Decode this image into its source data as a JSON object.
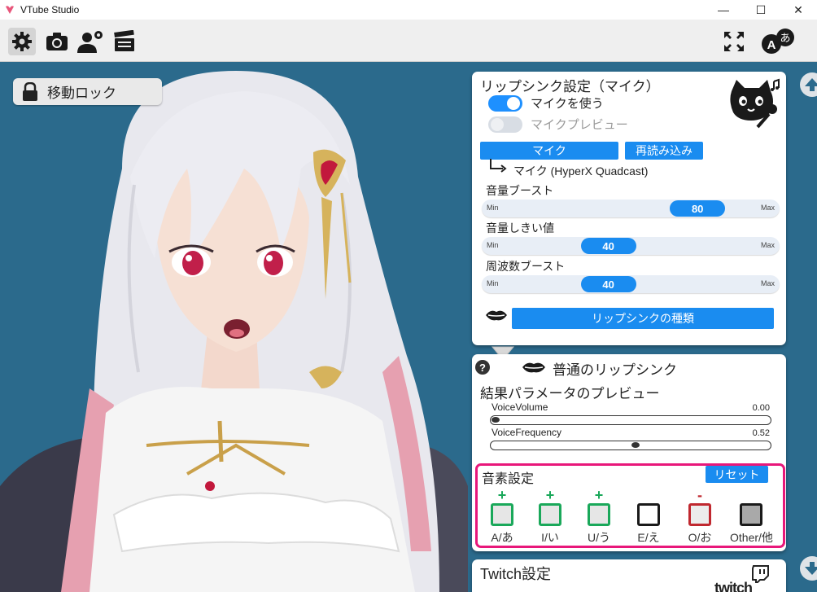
{
  "window": {
    "title": "VTube Studio",
    "controls": [
      "—",
      "☐",
      "✕"
    ]
  },
  "toolbar": {
    "left_icons": [
      "gear-icon",
      "camera-icon",
      "user-settings-icon",
      "clapperboard-icon"
    ],
    "right_icons": [
      "fullscreen-icon",
      "language-icon"
    ]
  },
  "stage": {
    "lock_label": "移動ロック"
  },
  "mic_panel": {
    "title": "リップシンク設定（マイク）",
    "use_mic_label": "マイクを使う",
    "use_mic_on": true,
    "mic_preview_label": "マイクプレビュー",
    "mic_preview_on": false,
    "mic_button": "マイク",
    "reload_button": "再読み込み",
    "mic_device": "マイク (HyperX Quadcast)",
    "sliders": [
      {
        "label": "音量ブースト",
        "value": "80",
        "level": 0.8,
        "min": "Min",
        "max": "Max"
      },
      {
        "label": "音量しきい値",
        "value": "40",
        "level": 0.4,
        "min": "Min",
        "max": "Max"
      },
      {
        "label": "周波数ブースト",
        "value": "40",
        "level": 0.4,
        "min": "Min",
        "max": "Max"
      }
    ],
    "lipsync_type_button": "リップシンクの種類"
  },
  "lipsync_panel": {
    "help": "?",
    "mode_title": "普通のリップシンク",
    "preview_title": "結果パラメータのプレビュー",
    "params": [
      {
        "name": "VoiceVolume",
        "value": "0.00",
        "level": 0.0
      },
      {
        "name": "VoiceFrequency",
        "value": "0.52",
        "level": 0.52
      }
    ],
    "phoneme": {
      "title": "音素設定",
      "reset_button": "リセット",
      "items": [
        {
          "label": "A/あ",
          "sign": "+",
          "state": "plus"
        },
        {
          "label": "I/い",
          "sign": "+",
          "state": "plus"
        },
        {
          "label": "U/う",
          "sign": "+",
          "state": "plus"
        },
        {
          "label": "E/え",
          "sign": "",
          "state": "neutral"
        },
        {
          "label": "O/お",
          "sign": "-",
          "state": "minus"
        },
        {
          "label": "Other/他",
          "sign": "",
          "state": "other"
        }
      ]
    }
  },
  "twitch_panel": {
    "title": "Twitch設定",
    "logo_text": "twitch"
  },
  "colors": {
    "background": "#2b6a8c",
    "accent": "#1a8cf0",
    "phoneme_highlight": "#e8177a",
    "plus": "#1aa85a",
    "minus": "#c0282f"
  }
}
